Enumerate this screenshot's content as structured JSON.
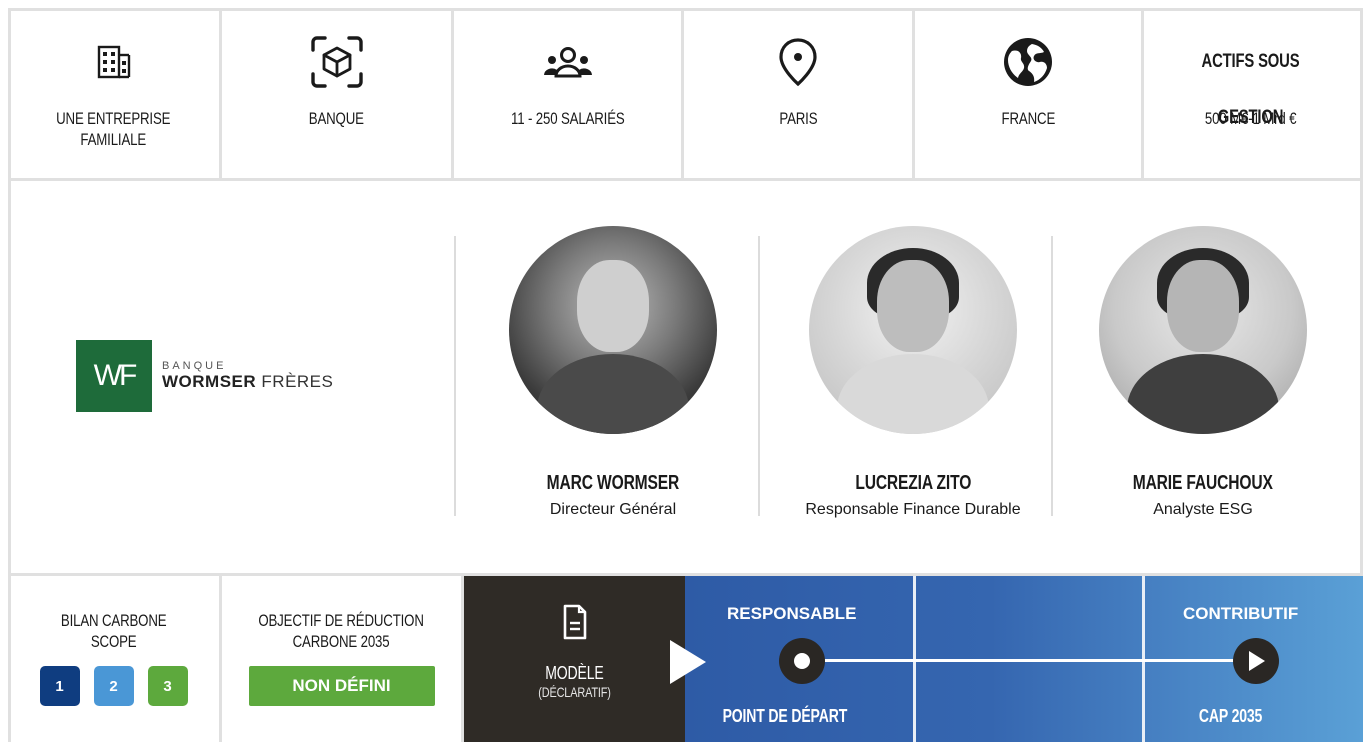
{
  "stats": [
    {
      "icon": "building-icon",
      "label": "UNE ENTREPRISE\nFAMILIALE"
    },
    {
      "icon": "cube-scan-icon",
      "label": "BANQUE"
    },
    {
      "icon": "people-group-icon",
      "label": "11 - 250 SALARIÉS"
    },
    {
      "icon": "location-pin-icon",
      "label": "PARIS"
    },
    {
      "icon": "globe-icon",
      "label": "FRANCE"
    },
    {
      "heading": "ACTIFS SOUS GESTION",
      "label": "500 M€-1 Mrd €"
    }
  ],
  "company": {
    "logo_mark": "WF",
    "logo_small": "BANQUE",
    "logo_bold": "WORMSER",
    "logo_rest": "FRÈRES",
    "brand_color": "#1e6b3a"
  },
  "people": [
    {
      "name": "MARC WORMSER",
      "role": "Directeur Général"
    },
    {
      "name": "LUCREZIA ZITO",
      "role": "Responsable Finance Durable"
    },
    {
      "name": "MARIE FAUCHOUX",
      "role": "Analyste ESG"
    }
  ],
  "carbon": {
    "title": "BILAN CARBONE\nSCOPE",
    "scopes": [
      {
        "label": "1",
        "color": "#0f3d80"
      },
      {
        "label": "2",
        "color": "#4a97d6"
      },
      {
        "label": "3",
        "color": "#5da93d"
      }
    ]
  },
  "objective": {
    "title": "OBJECTIF DE RÉDUCTION\nCARBONE  2035",
    "badge": "NON DÉFINI",
    "badge_color": "#5da93d"
  },
  "model": {
    "icon": "document-icon",
    "title": "MODÈLE",
    "subtitle": "(DÉCLARATIF)"
  },
  "trajectory": {
    "start_label": "RESPONSABLE",
    "start_sub": "POINT DE DÉPART",
    "end_label": "CONTRIBUTIF",
    "end_sub": "CAP 2035"
  }
}
